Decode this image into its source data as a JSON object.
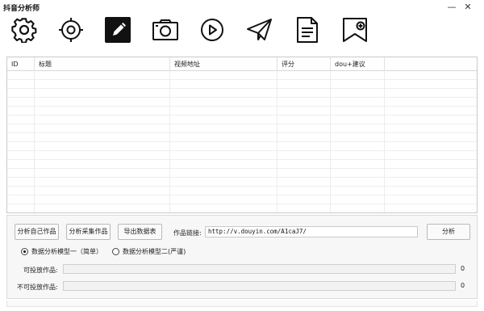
{
  "window": {
    "title": "抖音分析师",
    "minimize_glyph": "—",
    "close_glyph": "✕"
  },
  "toolbar": {
    "icons": [
      "gear-icon",
      "target-icon",
      "edit-icon",
      "camera-icon",
      "play-icon",
      "send-icon",
      "document-icon",
      "add-image-icon"
    ],
    "active_index": 2
  },
  "table": {
    "columns": [
      "ID",
      "标题",
      "视频地址",
      "评分",
      "dou+建议",
      ""
    ],
    "rows": []
  },
  "panel": {
    "btn_analyze_own": "分析自己作品",
    "btn_analyze_collected": "分析采集作品",
    "btn_export": "导出数据表",
    "link_label": "作品链接:",
    "link_value": "http://v.douyin.com/A1caJ7/",
    "btn_analyze": "分析",
    "model_simple": "数据分析模型一（简单）",
    "model_strict": "数据分析模型二(严谨)",
    "selected_model": "model_simple",
    "deliverable_label": "可投放作品:",
    "deliverable_count": "0",
    "deliverable_progress": 0,
    "undeliverable_label": "不可投放作品:",
    "undeliverable_count": "0",
    "undeliverable_progress": 0
  },
  "colors": {
    "accent": "#000000",
    "progress_fill": "#06b025"
  }
}
